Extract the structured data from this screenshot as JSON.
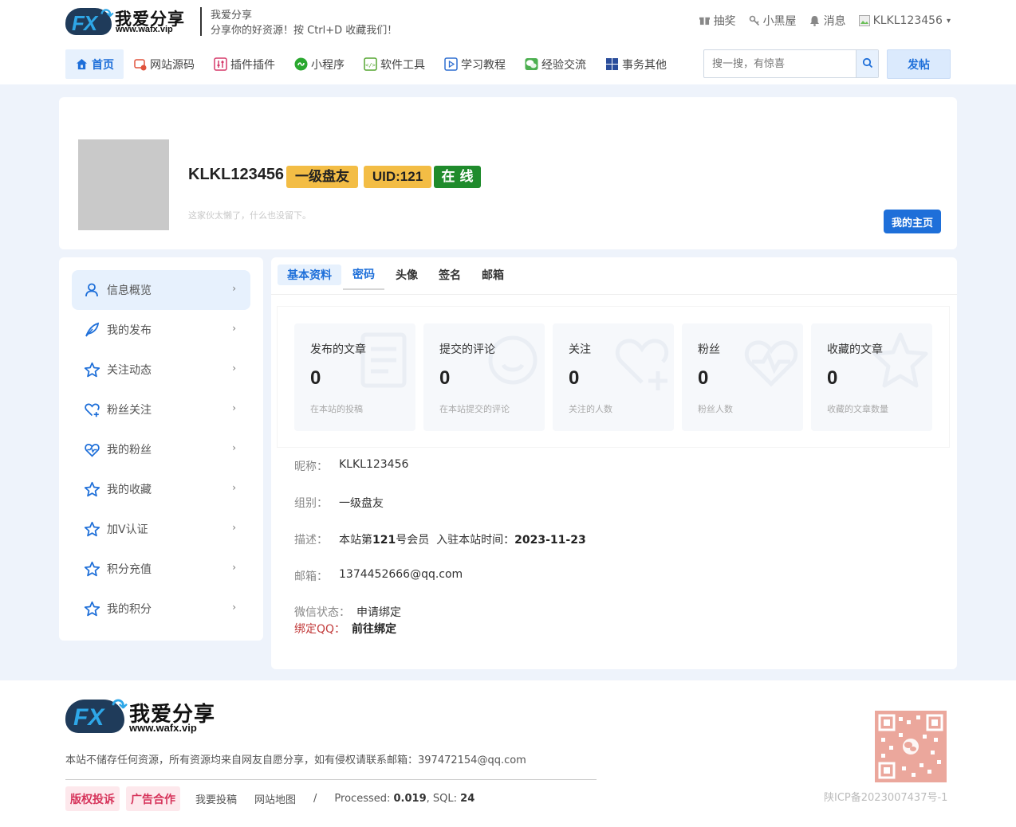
{
  "header": {
    "logo_text": "我爱分享",
    "logo_url": "www.wafx.vip",
    "site_title": "我爱分享",
    "site_slogan": "分享你的好资源！按 Ctrl+D 收藏我们！",
    "topbar": [
      {
        "label": "抽奖",
        "icon": "gift-icon"
      },
      {
        "label": "小黑屋",
        "icon": "key-icon"
      },
      {
        "label": "消息",
        "icon": "bell-icon"
      },
      {
        "label": "KLKL123456",
        "icon": "user-avatar-icon"
      }
    ],
    "nav": [
      {
        "label": "首页",
        "icon": "home-icon",
        "color": "#1e6fd9"
      },
      {
        "label": "网站源码",
        "icon": "code-window-icon",
        "color": "#e0533d"
      },
      {
        "label": "插件插件",
        "icon": "plugin-icon",
        "color": "#d63a6a"
      },
      {
        "label": "小程序",
        "icon": "mini-program-icon",
        "color": "#2aa82f"
      },
      {
        "label": "软件工具",
        "icon": "software-icon",
        "color": "#55a630"
      },
      {
        "label": "学习教程",
        "icon": "video-icon",
        "color": "#2f6fd1"
      },
      {
        "label": "经验交流",
        "icon": "wechat-icon",
        "color": "#4caf50"
      },
      {
        "label": "事务其他",
        "icon": "grid-icon",
        "color": "#2a4d9b"
      }
    ],
    "search_placeholder": "搜一搜，有惊喜",
    "post_label": "发帖"
  },
  "profile": {
    "username": "KLKL123456",
    "level": "一级盘友",
    "uid": "UID:121",
    "status": "在 线",
    "bio": "这家伙太懒了，什么也没留下。",
    "home_button": "我的主页"
  },
  "sidebar": {
    "items": [
      {
        "label": "信息概览",
        "icon": "user-icon"
      },
      {
        "label": "我的发布",
        "icon": "feather-icon"
      },
      {
        "label": "关注动态",
        "icon": "star-icon"
      },
      {
        "label": "粉丝关注",
        "icon": "heart-plus-icon"
      },
      {
        "label": "我的粉丝",
        "icon": "heart-pulse-icon"
      },
      {
        "label": "我的收藏",
        "icon": "star-icon"
      },
      {
        "label": "加V认证",
        "icon": "star-icon"
      },
      {
        "label": "积分充值",
        "icon": "star-icon"
      },
      {
        "label": "我的积分",
        "icon": "star-icon"
      }
    ],
    "chevron": "›"
  },
  "tabs": [
    "基本资料",
    "密码",
    "头像",
    "签名",
    "邮箱"
  ],
  "stats": [
    {
      "title": "发布的文章",
      "value": "0",
      "desc": "在本站的投稿",
      "icon": "document-icon"
    },
    {
      "title": "提交的评论",
      "value": "0",
      "desc": "在本站提交的评论",
      "icon": "comment-icon"
    },
    {
      "title": "关注",
      "value": "0",
      "desc": "关注的人数",
      "icon": "heart-plus-icon"
    },
    {
      "title": "粉丝",
      "value": "0",
      "desc": "粉丝人数",
      "icon": "heart-pulse-icon"
    },
    {
      "title": "收藏的文章",
      "value": "0",
      "desc": "收藏的文章数量",
      "icon": "star-icon"
    }
  ],
  "info": {
    "nickname_label": "昵称：",
    "nickname": "KLKL123456",
    "group_label": "组别：",
    "group": "一级盘友",
    "desc_label": "描述：",
    "desc_prefix": "本站第",
    "desc_num": "121",
    "desc_mid": "号会员  入驻本站时间：",
    "desc_date": "2023-11-23",
    "email_label": "邮箱：",
    "email": "1374452666@qq.com",
    "wechat_label": "微信状态：",
    "wechat_value": "申请绑定",
    "qq_label": "绑定QQ：",
    "qq_value": "前往绑定"
  },
  "footer": {
    "logo_text": "我爱分享",
    "logo_url": "www.wafx.vip",
    "notice": "本站不储存任何资源，所有资源均来自网友自愿分享，如有侵权请联系邮箱：397472154@qq.com",
    "tag1": "版权投诉",
    "tag2": "广告合作",
    "link1": "我要投稿",
    "link2": "网站地图",
    "sep": "/",
    "processed_label": "Processed:",
    "processed_value": "0.019",
    "sql_label": ", SQL:",
    "sql_value": "24",
    "icp": "陕ICP备2023007437号-1"
  },
  "colors": {
    "accent": "#1e6fd9",
    "badge": "#f3bd45",
    "online": "#1f8b2c",
    "page_bg": "#eef3fb"
  }
}
